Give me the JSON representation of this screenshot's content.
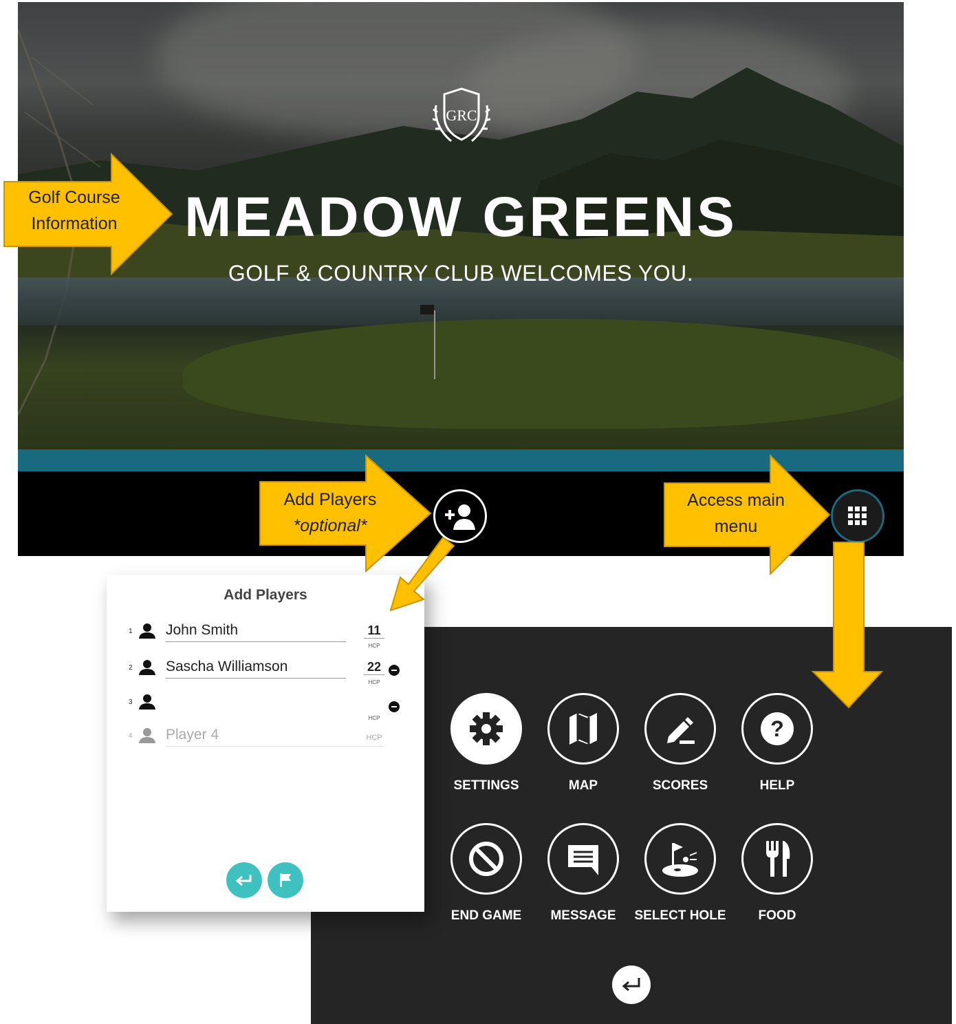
{
  "hero": {
    "crest_text": "GRC",
    "title": "MEADOW GREENS",
    "subtitle": "GOLF & COUNTRY CLUB WELCOMES YOU."
  },
  "callouts": {
    "course_info_line1": "Golf Course",
    "course_info_line2": "Information",
    "add_players_line1": "Add Players",
    "add_players_line2": "*optional*",
    "main_menu_line1": "Access main",
    "main_menu_line2": "menu"
  },
  "add_players": {
    "title": "Add Players",
    "hcp_label": "HCP",
    "players": [
      {
        "num": "1",
        "name": "John Smith",
        "hcp": "11"
      },
      {
        "num": "2",
        "name": "Sascha Williamson",
        "hcp": "22"
      },
      {
        "num": "3",
        "name": "",
        "hcp": ""
      },
      {
        "num": "4",
        "name": "Player 4",
        "hcp": ""
      }
    ]
  },
  "main_menu": {
    "items": [
      {
        "label": "SETTINGS",
        "icon": "gear-icon"
      },
      {
        "label": "MAP",
        "icon": "map-icon"
      },
      {
        "label": "SCORES",
        "icon": "pencil-icon"
      },
      {
        "label": "HELP",
        "icon": "question-icon"
      },
      {
        "label": "END GAME",
        "icon": "prohibited-icon"
      },
      {
        "label": "MESSAGE",
        "icon": "message-icon"
      },
      {
        "label": "SELECT HOLE",
        "icon": "golf-hole-icon"
      },
      {
        "label": "FOOD",
        "icon": "fork-knife-icon"
      }
    ]
  },
  "colors": {
    "accent_teal": "#1a6a7f",
    "button_teal": "#3fc1c0",
    "callout_yellow": "#ffc000",
    "menu_bg": "#252525"
  }
}
